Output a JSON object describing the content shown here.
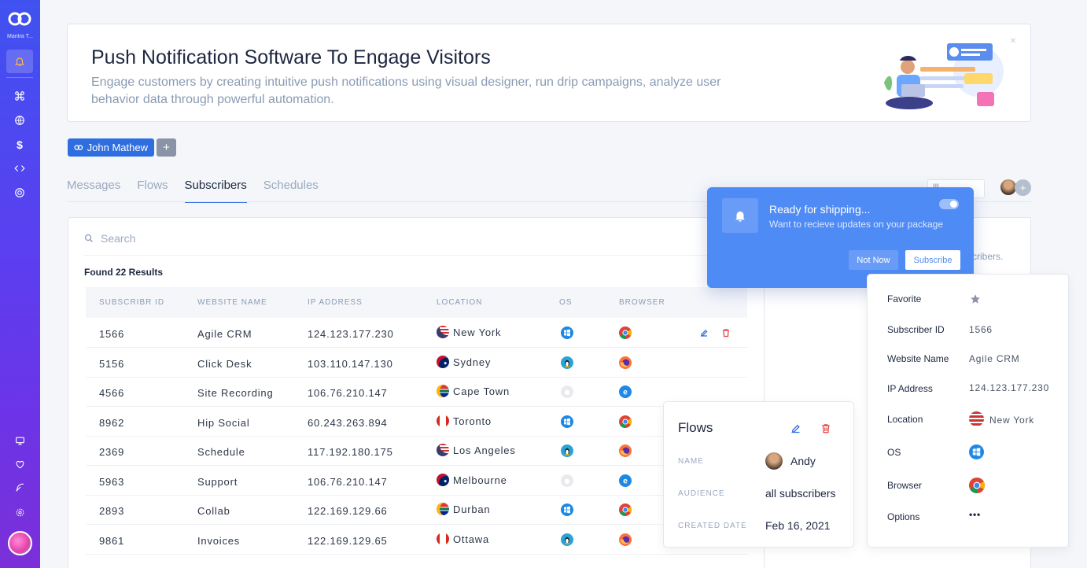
{
  "sidebar": {
    "brand": "Mantra T...",
    "icons": [
      "bell-icon",
      "command-icon",
      "globe-icon",
      "dollar-icon",
      "code-icon",
      "aperture-icon",
      "monitor-icon",
      "heart-icon",
      "feather-icon",
      "settings-icon"
    ]
  },
  "banner": {
    "title": "Push Notification Software To Engage Visitors",
    "description": "Engage customers by creating intuitive push notifications using visual designer, run drip campaigns, analyze user behavior data through powerful automation.",
    "close": "×"
  },
  "project": {
    "name": "John Mathew",
    "add": "+"
  },
  "tabs": [
    "Messages",
    "Flows",
    "Subscribers",
    "Schedules"
  ],
  "active_tab": "Subscribers",
  "header_control": "|||  ...",
  "header_add": "+",
  "search": {
    "placeholder": "Search"
  },
  "found": "Found 22 Results",
  "table": {
    "columns": [
      "SUBSCRIBR ID",
      "WEBSITE NAME",
      "IP ADDRESS",
      "LOCATION",
      "OS",
      "BROWSER"
    ],
    "rows": [
      {
        "id": "1566",
        "site": "Agile CRM",
        "ip": "124.123.177.230",
        "location": "New York",
        "flag": "us",
        "os": "windows",
        "browser": "chrome"
      },
      {
        "id": "5156",
        "site": "Click Desk",
        "ip": "103.110.147.130",
        "location": "Sydney",
        "flag": "au",
        "os": "linux",
        "browser": "firefox"
      },
      {
        "id": "4566",
        "site": "Site Recording",
        "ip": "106.76.210.147",
        "location": "Cape Town",
        "flag": "za",
        "os": "apple",
        "browser": "ie"
      },
      {
        "id": "8962",
        "site": "Hip Social",
        "ip": "60.243.263.894",
        "location": "Toronto",
        "flag": "ca",
        "os": "windows",
        "browser": "chrome"
      },
      {
        "id": "2369",
        "site": "Schedule",
        "ip": "117.192.180.175",
        "location": "Los Angeles",
        "flag": "us",
        "os": "linux",
        "browser": "firefox"
      },
      {
        "id": "5963",
        "site": "Support",
        "ip": "106.76.210.147",
        "location": "Melbourne",
        "flag": "au",
        "os": "apple",
        "browser": "ie"
      },
      {
        "id": "2893",
        "site": "Collab",
        "ip": "122.169.129.66",
        "location": "Durban",
        "flag": "za",
        "os": "windows",
        "browser": "chrome"
      },
      {
        "id": "9861",
        "site": "Invoices",
        "ip": "122.169.129.65",
        "location": "Ottawa",
        "flag": "ca",
        "os": "linux",
        "browser": "firefox"
      }
    ]
  },
  "right_panel_text": "scribers.",
  "notification": {
    "title": "Ready for shipping...",
    "subtitle": "Want to recieve updates on your package",
    "not_now": "Not Now",
    "subscribe": "Subscribe"
  },
  "flows_card": {
    "title": "Flows",
    "name_label": "NAME",
    "name_value": "Andy",
    "audience_label": "AUDIENCE",
    "audience_value": "all subscribers",
    "created_label": "CREATED DATE",
    "created_value": "Feb 16, 2021"
  },
  "details": {
    "favorite_label": "Favorite",
    "id_label": "Subscriber ID",
    "id_value": "1566",
    "site_label": "Website Name",
    "site_value": "Agile CRM",
    "ip_label": "IP Address",
    "ip_value": "124.123.177.230",
    "location_label": "Location",
    "location_value": "New York",
    "os_label": "OS",
    "browser_label": "Browser",
    "options_label": "Options",
    "options_value": "•••"
  },
  "colors": {
    "accent": "#2f6ee0",
    "notification": "#4f8bf5",
    "delete": "#e53e3e"
  }
}
